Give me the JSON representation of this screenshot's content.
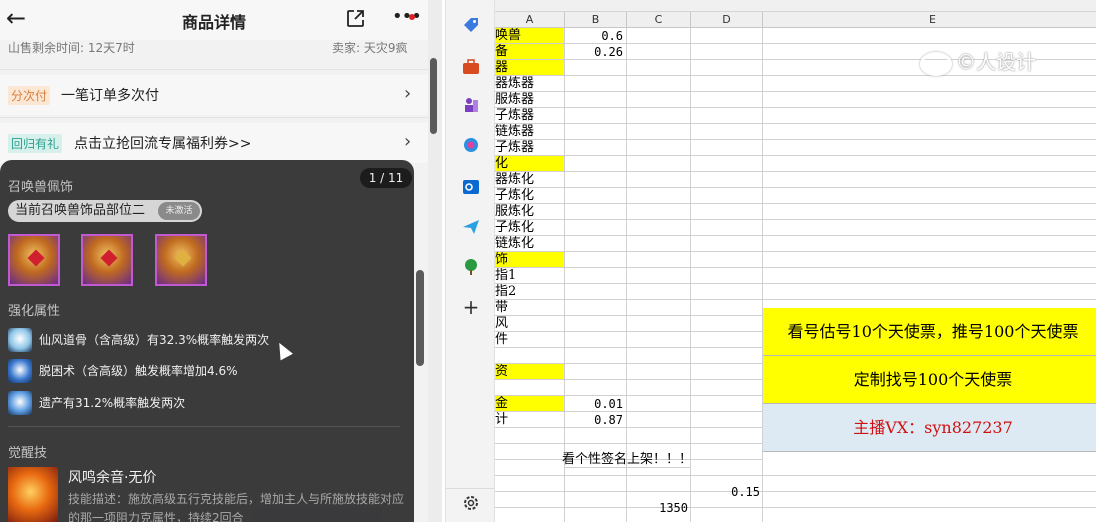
{
  "phone": {
    "title": "商品详情",
    "cut_left": "山售剩余时间: 12天7时",
    "cut_right": "卖家: 天灾9疯",
    "installment_tag": "分次付",
    "installment_text": "一笔订单多次付",
    "return_tag": "回归有礼",
    "return_text": "点击立抢回流专属福利券>>",
    "panel": {
      "section_accessory": "召唤兽佩饰",
      "counter": "1 / 11",
      "badge": "当前召唤兽饰品部位二",
      "badge_mini": "未激活",
      "section_enhance": "强化属性",
      "attrs": [
        {
          "text": "仙风道骨（含高级）有32.3%概率触发两次",
          "color": "#8fc6e8"
        },
        {
          "text": "脱困术（含高级）触发概率增加4.6%",
          "color": "#3a78d0"
        },
        {
          "text": "遗产有31.2%概率触发两次",
          "color": "#5a9ae0"
        }
      ],
      "section_awaken": "觉醒技",
      "skill_name": "风鸣余音·无价",
      "skill_desc": "技能描述：施放高级五行克技能后，增加主人与所施放技能对应的那一项阻力克属性，持续2回合"
    }
  },
  "sidebar": {
    "icons": [
      "tag-icon",
      "briefcase-icon",
      "chess-icon",
      "copilot-icon",
      "outlook-icon",
      "send-icon",
      "tree-icon",
      "plus-icon",
      "settings-icon"
    ]
  },
  "sheet": {
    "columns": [
      "A",
      "B",
      "C",
      "D",
      "E"
    ],
    "rows": [
      {
        "a": "唤兽",
        "b": "0.6",
        "yellow": true
      },
      {
        "a": "备",
        "b": "0.26",
        "yellow": true
      },
      {
        "a": "器",
        "b": "",
        "yellow": true
      },
      {
        "a": "器炼器",
        "b": "",
        "yellow": false
      },
      {
        "a": "服炼器",
        "b": "",
        "yellow": false
      },
      {
        "a": "子炼器",
        "b": "",
        "yellow": false
      },
      {
        "a": "链炼器",
        "b": "",
        "yellow": false
      },
      {
        "a": "子炼器",
        "b": "",
        "yellow": false
      },
      {
        "a": "化",
        "b": "",
        "yellow": true
      },
      {
        "a": "器炼化",
        "b": "",
        "yellow": false
      },
      {
        "a": "子炼化",
        "b": "",
        "yellow": false
      },
      {
        "a": "服炼化",
        "b": "",
        "yellow": false
      },
      {
        "a": "子炼化",
        "b": "",
        "yellow": false
      },
      {
        "a": "链炼化",
        "b": "",
        "yellow": false
      },
      {
        "a": "饰",
        "b": "",
        "yellow": true
      },
      {
        "a": "指1",
        "b": "",
        "yellow": false
      },
      {
        "a": "指2",
        "b": "",
        "yellow": false
      },
      {
        "a": "带",
        "b": "",
        "yellow": false
      },
      {
        "a": "风",
        "b": "",
        "yellow": false
      },
      {
        "a": "件",
        "b": "",
        "yellow": false
      },
      {
        "a": "",
        "b": "",
        "yellow": false
      },
      {
        "a": "资",
        "b": "",
        "yellow": true
      },
      {
        "a": "",
        "b": "",
        "yellow": false
      },
      {
        "a": "金",
        "b": "0.01",
        "yellow": true
      },
      {
        "a": "计",
        "b": "0.87",
        "yellow": false
      },
      {
        "a": "",
        "b": "",
        "yellow": false
      }
    ],
    "banner1": "看号估号10个天使票，推号100个天使票",
    "banner2": "定制找号100个天使票",
    "banner3": "主播VX：syn827237",
    "signature_note": "看个性签名上架！！！",
    "d_value": "0.15",
    "c_value": "1350",
    "watermark": "©人设计"
  }
}
